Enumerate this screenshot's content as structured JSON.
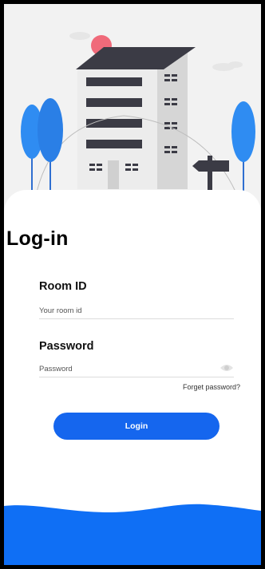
{
  "screen": {
    "title": "Log-in"
  },
  "room_field": {
    "label": "Room ID",
    "placeholder": "Your room id",
    "value": ""
  },
  "password_field": {
    "label": "Password",
    "placeholder": "Password",
    "value": "",
    "visibility_icon": "eye-icon"
  },
  "links": {
    "forgot_password": "Forget password?"
  },
  "actions": {
    "login_label": "Login"
  },
  "colors": {
    "primary": "#1566ee",
    "wave": "#0f6ff5",
    "building_dark": "#3b3b45",
    "building_light": "#e6e6e6",
    "sun": "#f06a7a",
    "tree": "#2f8cf2"
  },
  "illustration": {
    "name": "building-illustration"
  }
}
